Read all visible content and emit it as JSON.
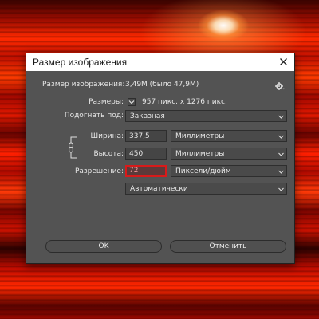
{
  "dialog": {
    "title": "Размер изображения",
    "image_size_label": "Размер изображения:",
    "image_size_value": "3,49M (было 47,9M)",
    "dimensions_label": "Размеры:",
    "dimensions_value": "957 пикс. x 1276 пикс.",
    "fit_to_label": "Подогнать под:",
    "fit_to_value": "Заказная",
    "width_label": "Ширина:",
    "width_value": "337,5",
    "width_unit": "Миллиметры",
    "height_label": "Высота:",
    "height_value": "450",
    "height_unit": "Миллиметры",
    "resolution_label": "Разрешение:",
    "resolution_value": "72",
    "resolution_unit": "Пиксели/дюйм",
    "resample_value": "Автоматически",
    "ok_label": "OK",
    "cancel_label": "Отменить"
  },
  "icons": {
    "close": "close-icon",
    "gear": "gear-icon",
    "chain": "chain-link-icon",
    "dropdown": "chevron-down-icon"
  },
  "colors": {
    "dialog_bg": "#535353",
    "active_field_border": "#d81a1a"
  }
}
